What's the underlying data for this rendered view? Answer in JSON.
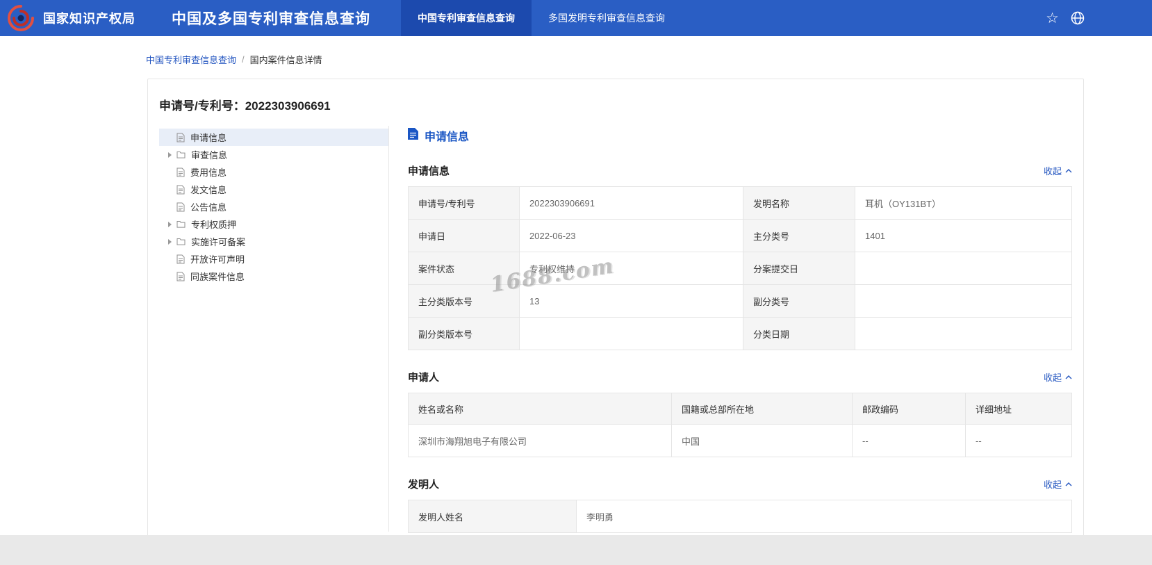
{
  "theme": {
    "header_blue": "#2a5ec4",
    "active_tab_blue": "#1c4aae",
    "link_blue": "#2456c0",
    "label_cell_gray": "#f5f5f5",
    "selected_item_bg": "#e8eef8"
  },
  "header": {
    "org_name": "国家知识产权局",
    "app_title": "中国及多国专利审查信息查询",
    "tabs": [
      {
        "label": "中国专利审查信息查询"
      },
      {
        "label": "多国发明专利审查信息查询"
      }
    ],
    "star_icon": "☆"
  },
  "breadcrumb": {
    "root": "中国专利审查信息查询",
    "separator": "/",
    "current": "国内案件信息详情"
  },
  "case": {
    "title": "申请号/专利号：2022303906691"
  },
  "sidebar": {
    "items": [
      {
        "label": "申请信息"
      },
      {
        "label": "审查信息"
      },
      {
        "label": "费用信息"
      },
      {
        "label": "发文信息"
      },
      {
        "label": "公告信息"
      },
      {
        "label": "专利权质押"
      },
      {
        "label": "实施许可备案"
      },
      {
        "label": "开放许可声明"
      },
      {
        "label": "同族案件信息"
      }
    ]
  },
  "content": {
    "header_title": "申请信息",
    "collapse_label": "收起",
    "app_info": {
      "title": "申请信息",
      "rows": [
        {
          "l1": "申请号/专利号",
          "v1": "2022303906691",
          "l2": "发明名称",
          "v2": "耳机（OY131BT）"
        },
        {
          "l1": "申请日",
          "v1": "2022-06-23",
          "l2": "主分类号",
          "v2": "1401"
        },
        {
          "l1": "案件状态",
          "v1": "专利权维持",
          "l2": "分案提交日",
          "v2": ""
        },
        {
          "l1": "主分类版本号",
          "v1": "13",
          "l2": "副分类号",
          "v2": ""
        },
        {
          "l1": "副分类版本号",
          "v1": "",
          "l2": "分类日期",
          "v2": ""
        }
      ]
    },
    "applicant": {
      "title": "申请人",
      "headers": [
        "姓名或名称",
        "国籍或总部所在地",
        "邮政编码",
        "详细地址"
      ],
      "rows": [
        [
          "深圳市海翔旭电子有限公司",
          "中国",
          "--",
          "--"
        ]
      ]
    },
    "inventor": {
      "title": "发明人",
      "rows": [
        {
          "label": "发明人姓名",
          "value": "李明勇"
        }
      ]
    }
  },
  "watermark": {
    "text": "1688.com"
  }
}
